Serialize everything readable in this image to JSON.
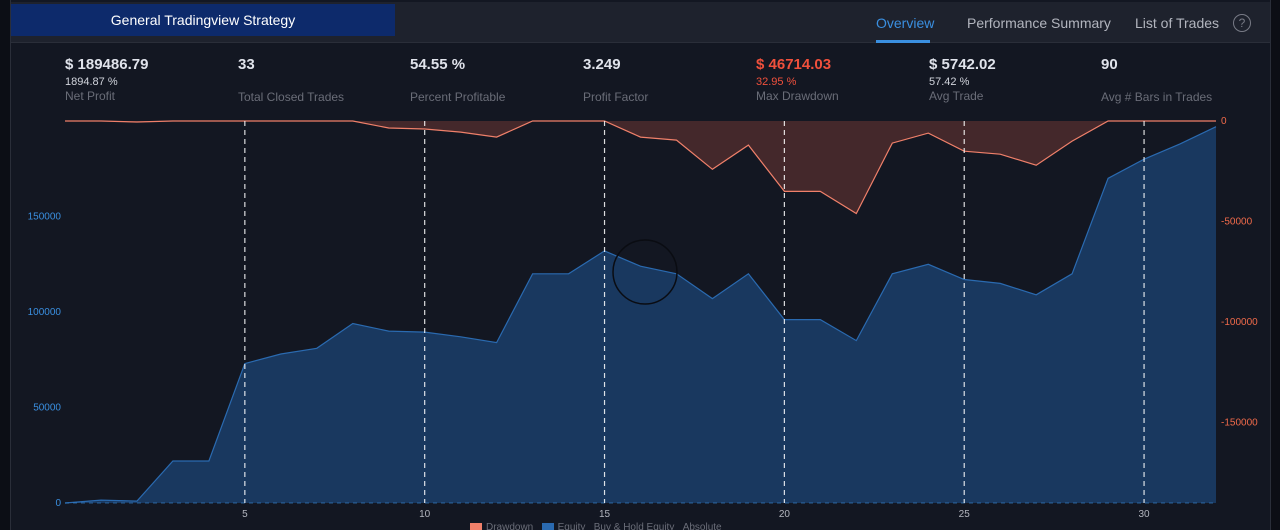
{
  "header": {
    "strategy_title": "General Tradingview Strategy",
    "tabs": [
      {
        "label": "Overview",
        "active": true
      },
      {
        "label": "Performance Summary",
        "active": false
      },
      {
        "label": "List of Trades",
        "active": false
      }
    ],
    "help_glyph": "?"
  },
  "metrics": [
    {
      "value": "$ 189486.79",
      "sub": "1894.87 %",
      "label": "Net Profit"
    },
    {
      "value": "33",
      "sub": "",
      "label": "Total Closed Trades"
    },
    {
      "value": "54.55 %",
      "sub": "",
      "label": "Percent Profitable"
    },
    {
      "value": "3.249",
      "sub": "",
      "label": "Profit Factor"
    },
    {
      "value": "$ 46714.03",
      "sub": "32.95 %",
      "label": "Max Drawdown"
    },
    {
      "value": "$ 5742.02",
      "sub": "57.42 %",
      "label": "Avg Trade"
    },
    {
      "value": "90",
      "sub": "",
      "label": "Avg # Bars in Trades"
    }
  ],
  "legend": {
    "drawdown": "Drawdown",
    "equity": "Equity",
    "buy_hold": "Buy & Hold Equity",
    "absolute": "Absolute"
  },
  "colors": {
    "equity": "#2a6ab0",
    "drawdown": "#f0806a",
    "accent": "#3a8fe0",
    "negative": "#f0503c"
  },
  "chart_data": {
    "type": "area",
    "x_ticks": [
      5,
      10,
      15,
      20,
      25,
      30
    ],
    "x": [
      0,
      1,
      2,
      3,
      4,
      5,
      6,
      7,
      8,
      9,
      10,
      11,
      12,
      13,
      14,
      15,
      16,
      17,
      18,
      19,
      20,
      21,
      22,
      23,
      24,
      25,
      26,
      27,
      28,
      29,
      30,
      31,
      32
    ],
    "series": [
      {
        "name": "Equity",
        "axis": "left",
        "values": [
          0,
          1500,
          1000,
          22000,
          22000,
          73000,
          78000,
          81000,
          94000,
          90000,
          89500,
          87000,
          84000,
          120000,
          120000,
          132000,
          124000,
          120000,
          107000,
          120000,
          96000,
          96000,
          85000,
          120000,
          125000,
          117000,
          115000,
          109000,
          120000,
          170000,
          180000,
          188000,
          197000
        ]
      },
      {
        "name": "Drawdown",
        "axis": "right",
        "values": [
          0,
          0,
          -500,
          0,
          0,
          0,
          0,
          0,
          0,
          -3500,
          -4000,
          -5500,
          -8000,
          0,
          0,
          0,
          -8000,
          -9500,
          -24000,
          -12000,
          -35000,
          -35000,
          -46000,
          -11000,
          -6000,
          -15000,
          -16500,
          -22000,
          -10000,
          0,
          0,
          0,
          0
        ]
      }
    ],
    "ylim_left": [
      0,
      200000
    ],
    "yticks_left": [
      0,
      50000,
      100000,
      150000
    ],
    "ytick_labels_left": [
      "0",
      "50000",
      "100000",
      "150000"
    ],
    "ylim_right": [
      -190000,
      0
    ],
    "yticks_right": [
      0,
      -50000,
      -100000,
      -150000
    ],
    "ytick_labels_right": [
      "0",
      "-50000",
      "-100000",
      "-150000"
    ]
  }
}
